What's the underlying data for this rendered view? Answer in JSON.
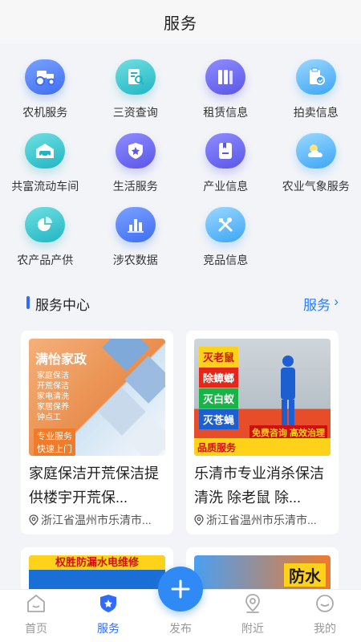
{
  "header": {
    "title": "服务"
  },
  "services": [
    {
      "label": "农机服务",
      "icon": "tractor-icon",
      "color": "blue"
    },
    {
      "label": "三资查询",
      "icon": "search-document-icon",
      "color": "teal"
    },
    {
      "label": "租赁信息",
      "icon": "books-icon",
      "color": "indigo"
    },
    {
      "label": "拍卖信息",
      "icon": "auction-document-icon",
      "color": "sky"
    },
    {
      "label": "共富流动车间",
      "icon": "garage-icon",
      "color": "teal"
    },
    {
      "label": "生活服务",
      "icon": "shield-star-icon",
      "color": "indigo"
    },
    {
      "label": "产业信息",
      "icon": "bookmark-document-icon",
      "color": "indigo"
    },
    {
      "label": "农业气象服务",
      "icon": "weather-icon",
      "color": "sky"
    },
    {
      "label": "农产品产供",
      "icon": "pie-chart-icon",
      "color": "teal"
    },
    {
      "label": "涉农数据",
      "icon": "bar-chart-icon",
      "color": "blue"
    },
    {
      "label": "竞品信息",
      "icon": "tools-icon",
      "color": "sky"
    }
  ],
  "section": {
    "title": "服务中心",
    "more_label": "服务"
  },
  "cards": [
    {
      "title": "家庭保洁开荒保洁提供楼宇开荒保...",
      "location": "浙江省温州市乐清市...",
      "image": {
        "brand": "满怡家政",
        "items": [
          "家庭保洁",
          "开荒保洁",
          "家电清洗",
          "家居保养",
          "钟点工"
        ],
        "tag1": "专业服务",
        "tag2": "快速上门"
      }
    },
    {
      "title": "乐清市专业消杀保洁清洗 除老鼠 除...",
      "location": "浙江省温州市乐清市...",
      "image": {
        "tags": [
          "灭老鼠",
          "除蟑螂",
          "灭白蚁",
          "灭苍蝇"
        ],
        "quality": "品质服务",
        "free": "免费咨询  高效治理"
      }
    },
    {
      "image": {
        "banner": "权胜防漏水电维修"
      }
    },
    {
      "image": {
        "badge": "防水"
      }
    }
  ],
  "tabs": [
    {
      "label": "首页",
      "icon": "home-icon"
    },
    {
      "label": "服务",
      "icon": "service-shield-icon"
    },
    {
      "label": "发布",
      "icon": "plus-icon"
    },
    {
      "label": "附近",
      "icon": "location-pin-icon"
    },
    {
      "label": "我的",
      "icon": "profile-icon"
    }
  ],
  "colors": {
    "accent": "#2f6bff",
    "link": "#2f7bf5",
    "tab_inactive": "#999999"
  }
}
